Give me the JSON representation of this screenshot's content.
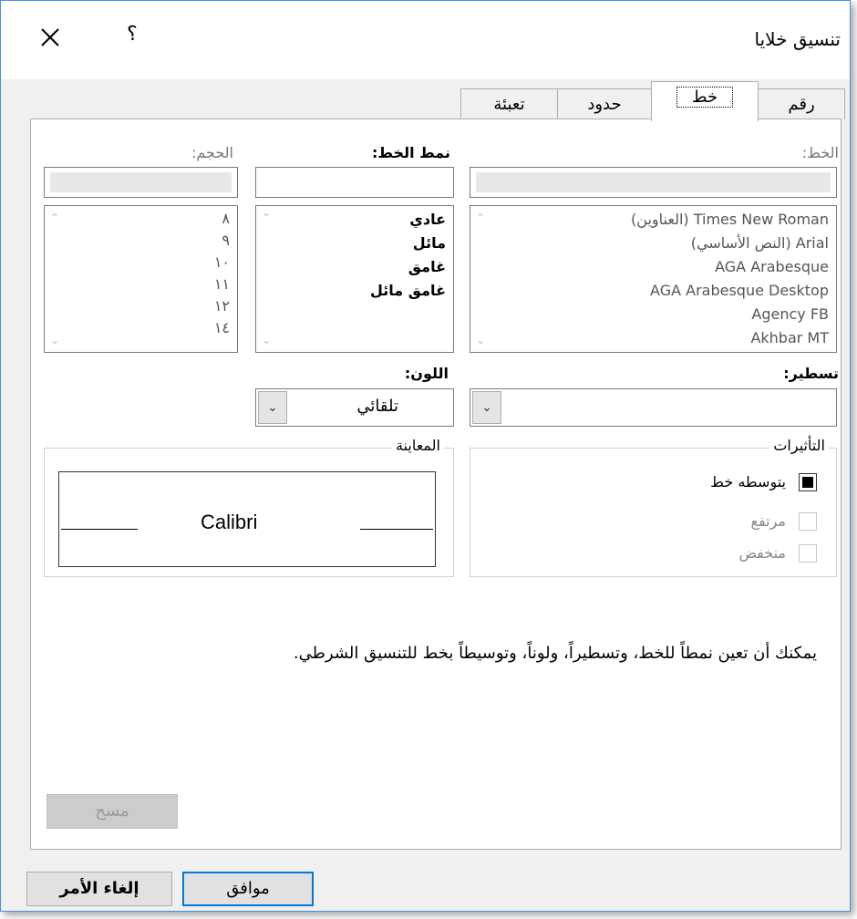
{
  "window": {
    "title": "تنسيق خلايا",
    "help": "؟",
    "close_icon": "close-icon"
  },
  "tabs": [
    {
      "label": "رقم",
      "active": false
    },
    {
      "label": "خط",
      "active": true
    },
    {
      "label": "حدود",
      "active": false
    },
    {
      "label": "تعبئة",
      "active": false
    }
  ],
  "font": {
    "label": "الخط:",
    "value": "",
    "items": [
      "Times New Roman (العناوين)",
      "Arial (النص الأساسي)",
      "AGA Arabesque",
      "AGA Arabesque Desktop",
      "Agency FB",
      "Akhbar MT"
    ]
  },
  "style": {
    "label": "نمط الخط:",
    "value": "",
    "items": [
      "عادي",
      "مائل",
      "غامق",
      "غامق مائل"
    ]
  },
  "size": {
    "label": "الحجم:",
    "value": "",
    "items": [
      "٨",
      "٩",
      "١٠",
      "١١",
      "١٢",
      "١٤"
    ]
  },
  "underline": {
    "label": "تسطير:",
    "value": ""
  },
  "color": {
    "label": "اللون:",
    "value": "تلقائي"
  },
  "effects": {
    "legend": "التأثيرات",
    "items": [
      {
        "label": "يتوسطه خط",
        "checked": true,
        "enabled": true
      },
      {
        "label": "مرتفع",
        "checked": false,
        "enabled": false
      },
      {
        "label": "منخفض",
        "checked": false,
        "enabled": false
      }
    ]
  },
  "preview": {
    "legend": "المعاينة",
    "text": "Calibri"
  },
  "description": "يمكنك أن تعين نمطاً للخط، وتسطيراً، ولوناً، وتوسيطاً بخط للتنسيق الشرطي.",
  "buttons": {
    "clear": "مسح",
    "ok": "موافق",
    "cancel": "إلغاء الأمر"
  },
  "colors": {
    "accent": "#0078d7",
    "dialog_bg": "#f0f0f0"
  }
}
